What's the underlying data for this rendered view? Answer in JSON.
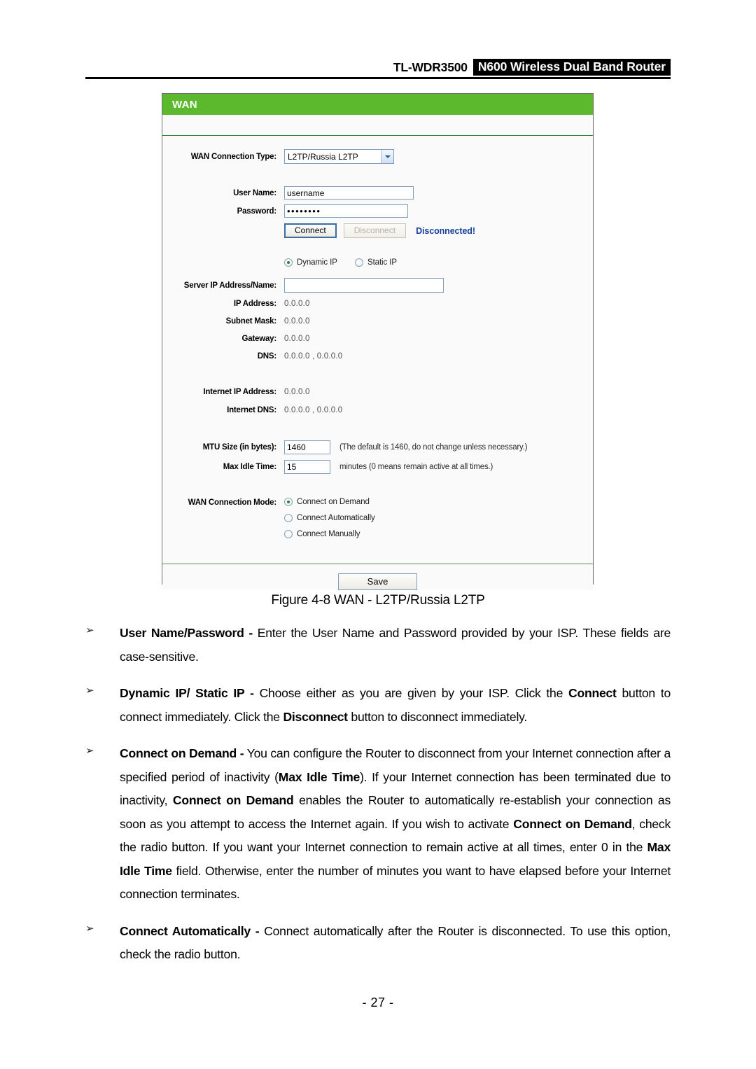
{
  "header": {
    "model": "TL-WDR3500",
    "product": "N600 Wireless Dual Band Router"
  },
  "panel": {
    "title": "WAN",
    "connection_type": {
      "label": "WAN Connection Type:",
      "value": "L2TP/Russia L2TP",
      "arrow_icon": "chevron-down-icon"
    },
    "user_name": {
      "label": "User Name:",
      "value": "username"
    },
    "password": {
      "label": "Password:",
      "value": "••••••••"
    },
    "connect_button": "Connect",
    "disconnect_button": "Disconnect",
    "status": "Disconnected!",
    "ip_mode": {
      "dynamic_label": "Dynamic IP",
      "static_label": "Static IP",
      "selected": "Dynamic IP"
    },
    "server_ip": {
      "label": "Server IP Address/Name:",
      "value": ""
    },
    "readonly_fields": [
      {
        "label": "IP Address:",
        "value": "0.0.0.0"
      },
      {
        "label": "Subnet Mask:",
        "value": "0.0.0.0"
      },
      {
        "label": "Gateway:",
        "value": "0.0.0.0"
      },
      {
        "label": "DNS:",
        "value": "0.0.0.0 , 0.0.0.0"
      }
    ],
    "internet_fields": [
      {
        "label": "Internet IP Address:",
        "value": "0.0.0.0"
      },
      {
        "label": "Internet DNS:",
        "value": "0.0.0.0 , 0.0.0.0"
      }
    ],
    "mtu": {
      "label": "MTU Size (in bytes):",
      "value": "1460",
      "hint": "(The default is 1460, do not change unless necessary.)"
    },
    "max_idle": {
      "label": "Max Idle Time:",
      "value": "15",
      "hint": "minutes (0 means remain active at all times.)"
    },
    "connection_mode": {
      "label": "WAN Connection Mode:",
      "options": [
        {
          "label": "Connect on Demand",
          "selected": true
        },
        {
          "label": "Connect Automatically",
          "selected": false
        },
        {
          "label": "Connect Manually",
          "selected": false
        }
      ]
    },
    "save_button": "Save"
  },
  "caption": "Figure 4-8 WAN - L2TP/Russia L2TP",
  "bullets": [
    {
      "marker": "➢",
      "html": "<b>User Name/Password -</b> Enter the User Name and Password provided by your ISP. These fields are case-sensitive."
    },
    {
      "marker": "➢",
      "html": "<b>Dynamic IP/ Static IP -</b> Choose either as you are given by your ISP. Click the <b>Connect</b> button to connect immediately. Click the <b>Disconnect</b> button to disconnect immediately."
    },
    {
      "marker": "➢",
      "html": "<b>Connect on Demand -</b> You can configure the Router to disconnect from your Internet connection after a specified period of inactivity (<b>Max Idle Time</b>). If your Internet connection has been terminated due to inactivity, <b>Connect on Demand</b> enables the Router to automatically re-establish your connection as soon as you attempt to access the Internet again. If you wish to activate <b>Connect on Demand</b>, check the radio button. If you want your Internet connection to remain active at all times, enter 0 in the <b>Max Idle Time</b> field. Otherwise, enter the number of minutes you want to have elapsed before your Internet connection terminates."
    },
    {
      "marker": "➢",
      "html": "<b>Connect Automatically -</b> Connect automatically after the Router is disconnected. To use this option, check the radio button."
    }
  ],
  "footer": {
    "page": "- 27 -"
  },
  "colors": {
    "panel_green": "#5cb82c",
    "status_blue": "#16409b",
    "divider_green": "#2e7a2e"
  }
}
